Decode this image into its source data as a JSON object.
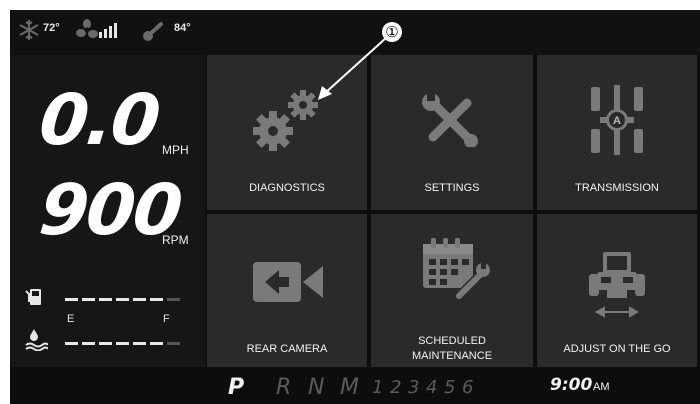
{
  "status": {
    "ac_temp": "72°",
    "outside_temp": "84°"
  },
  "callout": {
    "number": "①"
  },
  "speed": {
    "value": "0.0",
    "unit": "MPH"
  },
  "rpm": {
    "value": "900",
    "unit": "RPM"
  },
  "fuel": {
    "empty_label": "E",
    "full_label": "F",
    "level": 0.86
  },
  "def": {
    "level": 0.86
  },
  "tiles": {
    "diagnostics": "DIAGNOSTICS",
    "settings": "SETTINGS",
    "transmission": "TRANSMISSION",
    "rear_camera": "REAR CAMERA",
    "scheduled_maintenance_1": "SCHEDULED",
    "scheduled_maintenance_2": "MAINTENANCE",
    "adjust": "ADJUST ON THE GO"
  },
  "transmission_badge": "A",
  "gears": {
    "p": "P",
    "r": "R",
    "n": "N",
    "m": "M",
    "g1": "1",
    "g2": "2",
    "g3": "3",
    "g4": "4",
    "g5": "5",
    "g6": "6"
  },
  "clock": {
    "time": "9:00",
    "ampm": "AM"
  },
  "icons": [
    "snowflake-icon",
    "fan-icon",
    "signal-bars-icon",
    "thermometer-icon",
    "gears-icon",
    "tools-icon",
    "transmission-icon",
    "camera-icon",
    "calendar-wrench-icon",
    "tractor-icon",
    "fuel-icon",
    "def-fluid-icon"
  ]
}
